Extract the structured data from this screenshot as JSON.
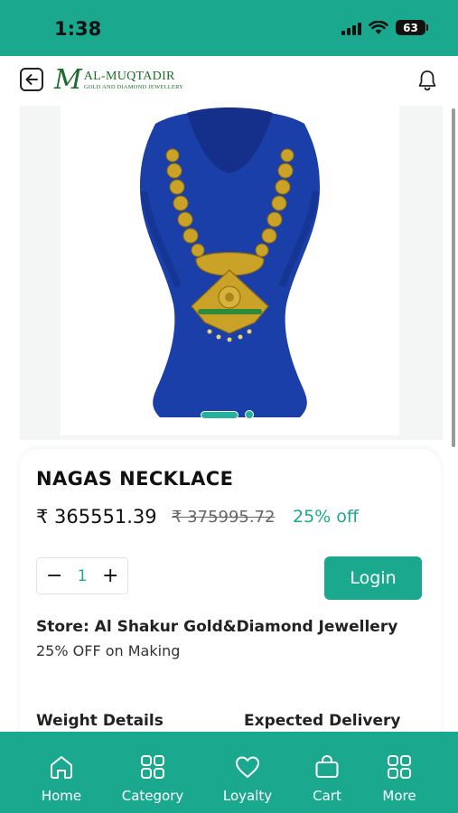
{
  "status_bar": {
    "time": "1:38",
    "battery": "63"
  },
  "header": {
    "logo_mark": "M",
    "logo_name": "AL-MUQTADIR",
    "logo_tagline": "GOLD AND DIAMOND JEWELLERY"
  },
  "gallery": {
    "image_count": 2,
    "active_index": 0
  },
  "product": {
    "name": "NAGAS NECKLACE",
    "price": "₹ 365551.39",
    "mrp": "₹ 375995.72",
    "discount": "25% off",
    "quantity": "1",
    "qty_minus": "−",
    "qty_plus": "+",
    "login_label": "Login",
    "store": "Store: Al Shakur Gold&Diamond Jewellery",
    "offer": "25% OFF on Making",
    "weight_heading": "Weight Details",
    "delivery_heading": "Expected Delivery"
  },
  "bottom_nav": [
    {
      "label": "Home",
      "icon": "home-icon"
    },
    {
      "label": "Category",
      "icon": "grid-icon"
    },
    {
      "label": "Loyalty",
      "icon": "heart-icon"
    },
    {
      "label": "Cart",
      "icon": "bag-icon"
    },
    {
      "label": "More",
      "icon": "grid-icon"
    }
  ],
  "colors": {
    "accent": "#1aa98f",
    "velvet": "#1b3fa8",
    "gold": "#c9a227"
  }
}
